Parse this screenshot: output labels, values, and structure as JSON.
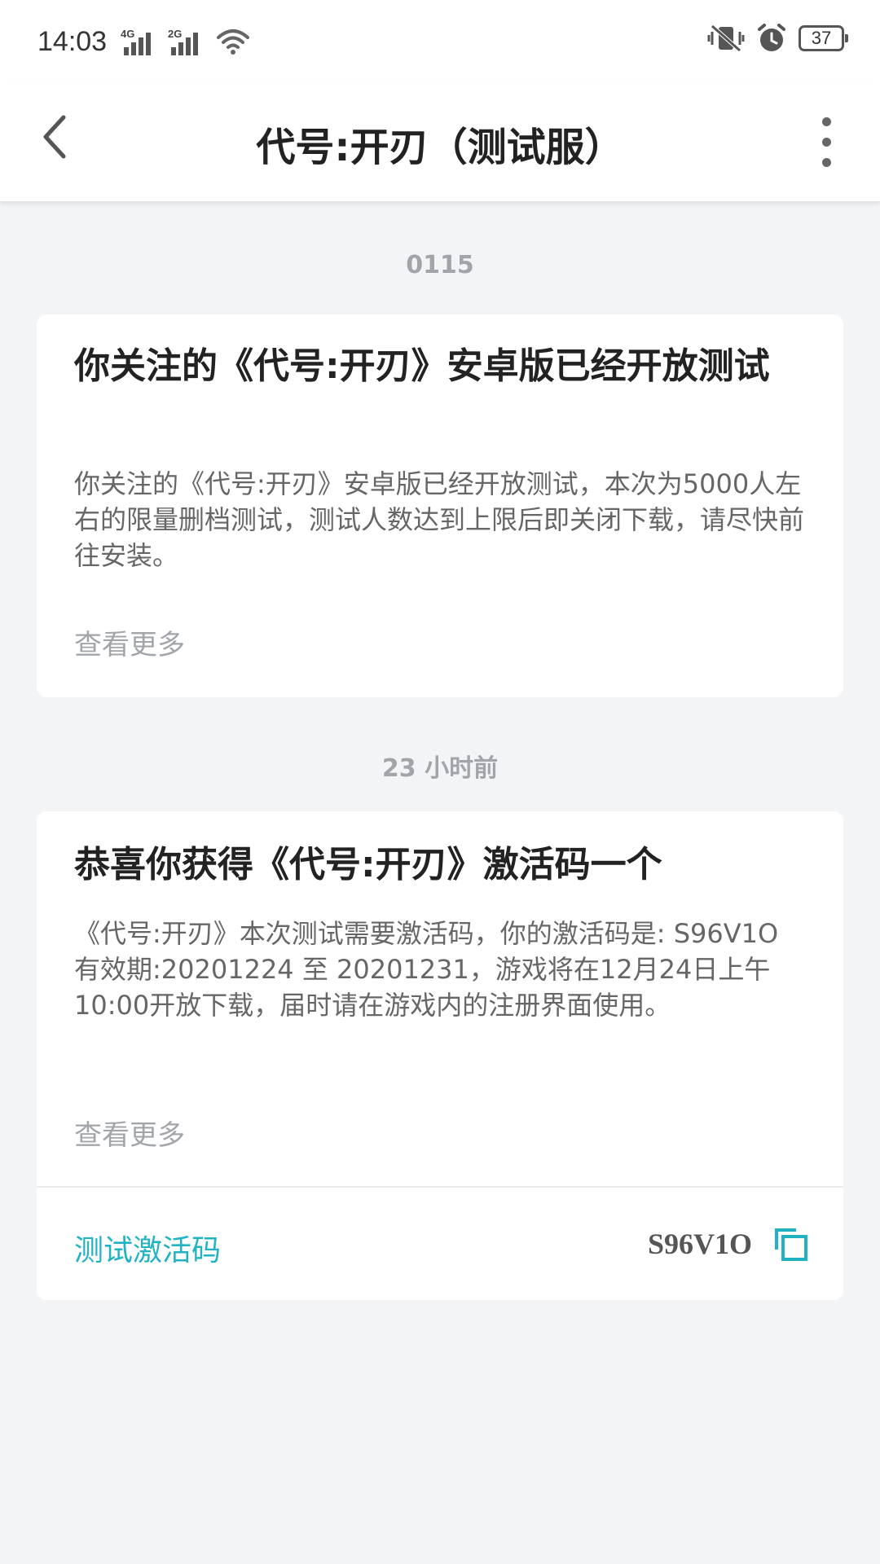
{
  "status_bar": {
    "time": "14:03",
    "signal_1_label": "4G",
    "signal_2_label": "2G",
    "battery_level": "37",
    "icons": [
      "signal-4g-icon",
      "signal-2g-icon",
      "wifi-icon",
      "vibrate-mute-icon",
      "alarm-icon",
      "battery-icon"
    ]
  },
  "app_bar": {
    "title": "代号:开刃（测试服）",
    "back_icon": "chevron-left-icon",
    "more_icon": "more-vertical-icon"
  },
  "messages": [
    {
      "timestamp": "0115",
      "title": "你关注的《代号:开刃》安卓版已经开放测试",
      "body": "你关注的《代号:开刃》安卓版已经开放测试，本次为5000人左右的限量删档测试，测试人数达到上限后即关闭下载，请尽快前往安装。",
      "view_more": "查看更多"
    },
    {
      "timestamp": "23 小时前",
      "title": "恭喜你获得《代号:开刃》激活码一个",
      "body": "《代号:开刃》本次测试需要激活码，你的激活码是: S96V1O 有效期:20201224 至 20201231，游戏将在12月24日上午10:00开放下载，届时请在游戏内的注册界面使用。",
      "view_more": "查看更多",
      "code_label": "测试激活码",
      "code_value": "S96V1O",
      "copy_icon": "copy-icon"
    }
  ],
  "colors": {
    "accent": "#21b3c3",
    "background": "#f3f4f6",
    "card": "#ffffff"
  }
}
